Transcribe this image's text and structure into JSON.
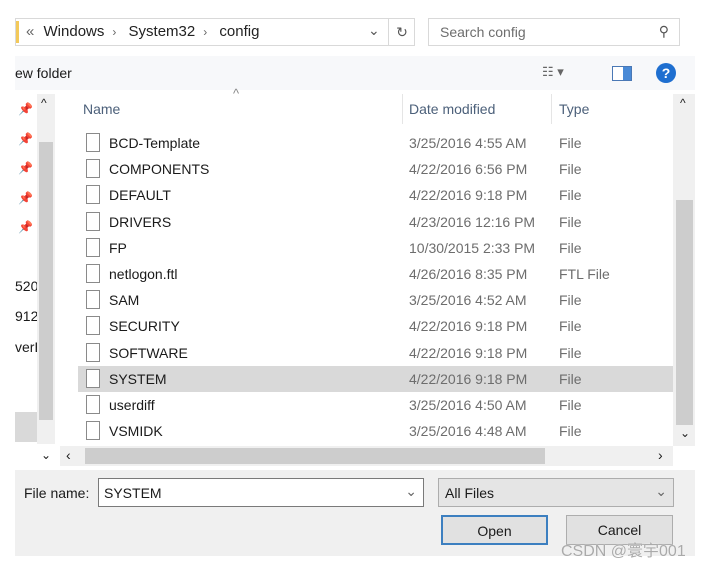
{
  "address": {
    "breadcrumbs": [
      "Windows",
      "System32",
      "config"
    ],
    "overflow": "«"
  },
  "search": {
    "placeholder": "Search config"
  },
  "toolbar": {
    "new_folder": "ew folder",
    "help": "?"
  },
  "nav": {
    "partial_items": [
      "520",
      "912",
      "verE"
    ]
  },
  "columns": {
    "name": "Name",
    "date": "Date modified",
    "type": "Type"
  },
  "files": [
    {
      "name": "BCD-Template",
      "date": "3/25/2016 4:55 AM",
      "type": "File"
    },
    {
      "name": "COMPONENTS",
      "date": "4/22/2016 6:56 PM",
      "type": "File"
    },
    {
      "name": "DEFAULT",
      "date": "4/22/2016 9:18 PM",
      "type": "File"
    },
    {
      "name": "DRIVERS",
      "date": "4/23/2016 12:16 PM",
      "type": "File"
    },
    {
      "name": "FP",
      "date": "10/30/2015 2:33 PM",
      "type": "File"
    },
    {
      "name": "netlogon.ftl",
      "date": "4/26/2016 8:35 PM",
      "type": "FTL File"
    },
    {
      "name": "SAM",
      "date": "3/25/2016 4:52 AM",
      "type": "File"
    },
    {
      "name": "SECURITY",
      "date": "4/22/2016 9:18 PM",
      "type": "File"
    },
    {
      "name": "SOFTWARE",
      "date": "4/22/2016 9:18 PM",
      "type": "File"
    },
    {
      "name": "SYSTEM",
      "date": "4/22/2016 9:18 PM",
      "type": "File",
      "selected": true
    },
    {
      "name": "userdiff",
      "date": "3/25/2016 4:50 AM",
      "type": "File"
    },
    {
      "name": "VSMIDK",
      "date": "3/25/2016 4:48 AM",
      "type": "File"
    }
  ],
  "footer": {
    "file_name_label": "File name:",
    "file_name_value": "SYSTEM",
    "filter": "All Files",
    "open": "Open",
    "cancel": "Cancel"
  },
  "watermark": "CSDN @寰宇001",
  "colors": {
    "selected_row": "#d9d9d9",
    "accent": "#1f6fd0"
  }
}
